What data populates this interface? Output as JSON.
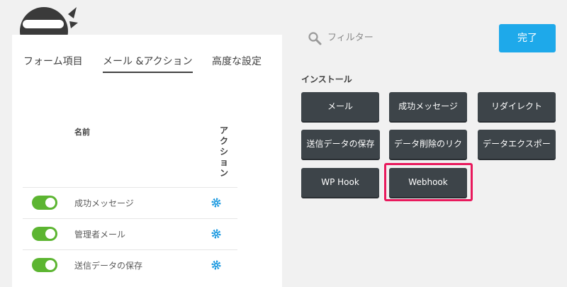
{
  "tabs": [
    {
      "label": "フォーム項目"
    },
    {
      "label": "メール &アクション"
    },
    {
      "label": "高度な設定"
    }
  ],
  "table": {
    "header_name": "名前",
    "header_action": "アクション",
    "rows": [
      {
        "label": "成功メッセージ",
        "enabled": true
      },
      {
        "label": "管理者メール",
        "enabled": true
      },
      {
        "label": "送信データの保存",
        "enabled": true
      }
    ]
  },
  "search": {
    "placeholder": "フィルター"
  },
  "done_label": "完了",
  "install": {
    "title": "インストール",
    "actions": [
      {
        "label": "メール"
      },
      {
        "label": "成功メッセージ"
      },
      {
        "label": "リダイレクト"
      },
      {
        "label": "送信データの保存"
      },
      {
        "label": "データ削除のリク"
      },
      {
        "label": "データエクスポー"
      },
      {
        "label": "WP Hook"
      },
      {
        "label": "Webhook"
      }
    ]
  },
  "colors": {
    "accent": "#1ea9ea",
    "toggle_on": "#5cb531",
    "highlight": "#e8195c",
    "action_button": "#3d4449"
  },
  "icons": [
    "ninja-logo-icon",
    "search-icon",
    "gear-icon"
  ]
}
